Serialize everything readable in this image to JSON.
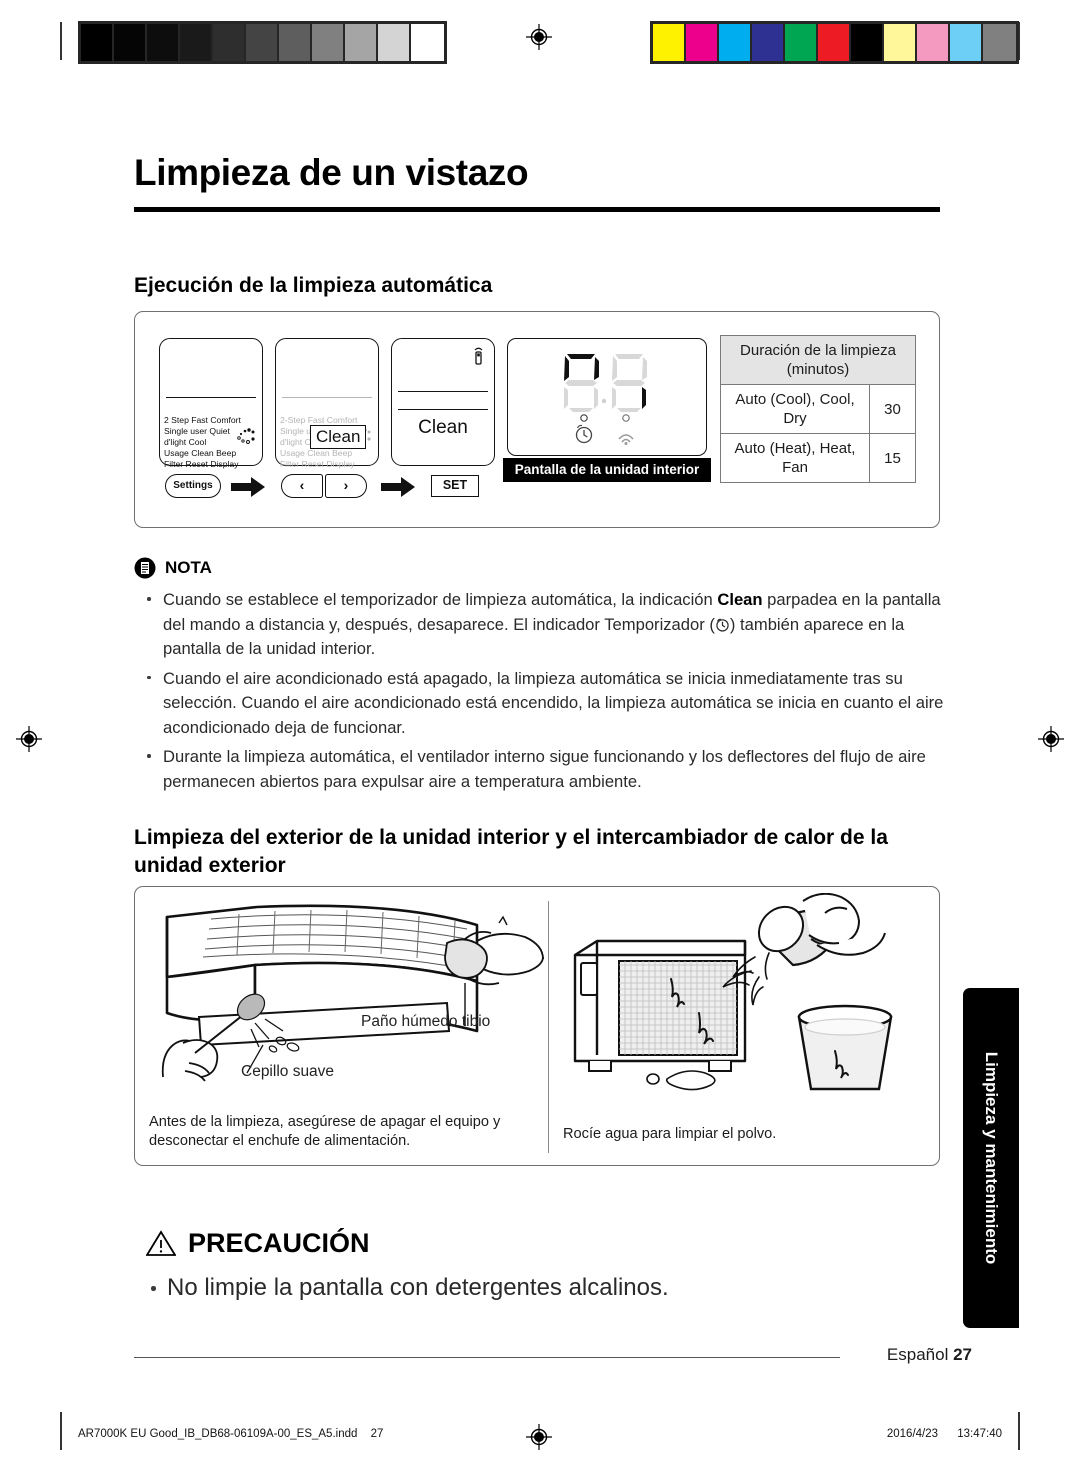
{
  "print_marks": {
    "gray_bar": [
      "#000000",
      "#050505",
      "#0d0d0d",
      "#1a1a1a",
      "#2e2e2e",
      "#444444",
      "#5e5e5e",
      "#808080",
      "#a5a5a5",
      "#d4d4d4",
      "#ffffff"
    ],
    "color_bar": [
      "#fff200",
      "#ec008c",
      "#00aeef",
      "#2e3192",
      "#00a651",
      "#ed1c24",
      "#000000",
      "#fff799",
      "#f49ac1",
      "#6dcff6",
      "#808080"
    ],
    "registration_icon": "registration-target-icon"
  },
  "header": {
    "title": "Limpieza de un vistazo"
  },
  "auto_clean": {
    "heading": "Ejecución de la limpieza automática",
    "remote1": {
      "lines": [
        "2 Step   Fast  Comfort",
        "Single user  Quiet",
        "d'light Cool",
        "Usage   Clean   Beep",
        "Filter Reset    Display"
      ]
    },
    "remote2": {
      "lines": [
        "2-Step   Fast  Comfort",
        "Single user  Quiet",
        "d'light Cool",
        "Usage   Clean   Beep",
        "Filter Reset    Display"
      ],
      "badge": "Clean"
    },
    "remote3": {
      "selected": "Clean"
    },
    "buttons": {
      "settings": "Settings",
      "prev": "‹",
      "next": "›",
      "set": "SET"
    },
    "display_panel": {
      "caption": "Pantalla de la unidad interior",
      "segments": "88",
      "indicators": [
        "timer-icon",
        "wifi-icon"
      ]
    },
    "duration_table": {
      "header": "Duración de la limpieza (minutos)",
      "rows": [
        {
          "mode": "Auto (Cool), Cool, Dry",
          "minutes": "30"
        },
        {
          "mode": "Auto (Heat), Heat, Fan",
          "minutes": "15"
        }
      ]
    }
  },
  "nota": {
    "label": "NOTA",
    "icon": "note-document-icon",
    "bullets": [
      {
        "pre": "Cuando se establece el temporizador de limpieza automática, la indicación ",
        "bold": "Clean",
        "mid": " parpadea en la pantalla del mando a distancia y, después, desaparece. El indicador Temporizador (",
        "icon": "timer-icon",
        "post": ") también aparece en la pantalla de la unidad interior."
      },
      {
        "text": "Cuando el aire acondicionado está apagado, la limpieza automática se inicia inmediatamente tras su selección. Cuando el aire acondicionado está encendido, la limpieza automática se inicia en cuanto el aire acondicionado deja de funcionar."
      },
      {
        "text": "Durante la limpieza automática, el ventilador interno sigue funcionando y los deflectores del flujo de aire permanecen abiertos para expulsar aire a temperatura ambiente."
      }
    ]
  },
  "exterior_cleaning": {
    "heading": "Limpieza del exterior de la unidad interior y el intercambiador de calor de la unidad exterior",
    "indoor": {
      "label_cloth": "Paño húmedo tibio",
      "label_brush": "Cepillo suave",
      "caption": "Antes de la limpieza, asegúrese de apagar el equipo y desconectar el enchufe de alimentación."
    },
    "outdoor": {
      "caption": "Rocíe agua para limpiar el polvo."
    }
  },
  "precaucion": {
    "label": "PRECAUCIÓN",
    "icon": "warning-triangle-icon",
    "bullets": [
      {
        "text": "No limpie la pantalla con detergentes alcalinos."
      }
    ]
  },
  "side_tab": {
    "label": "Limpieza y mantenimiento"
  },
  "footer": {
    "language": "Español",
    "page_number": "27",
    "print_file": "AR7000K EU Good_IB_DB68-06109A-00_ES_A5.indd",
    "print_page": "27",
    "print_date": "2016/4/23",
    "print_time": "13:47:40"
  }
}
